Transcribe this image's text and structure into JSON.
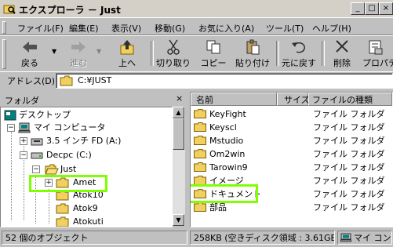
{
  "window": {
    "title": "エクスプローラ － Just",
    "min_glyph": "_",
    "max_glyph": "□",
    "close_glyph": "×"
  },
  "menu": [
    "ファイル(F)",
    "編集(E)",
    "表示(V)",
    "移動(G)",
    "お気に入り(A)",
    "ツール(T)",
    "ヘルプ(H)"
  ],
  "toolbar": {
    "back": "戻る",
    "forward": "進む",
    "up": "上へ",
    "cut": "切り取り",
    "copy": "コピー",
    "paste": "貼り付け",
    "undo": "元に戻す",
    "delete": "削除",
    "properties": "プロパティ"
  },
  "address": {
    "label": "アドレス(D)",
    "value": "C:¥JUST"
  },
  "tree": {
    "header": "フォルダ",
    "close_glyph": "×",
    "items": [
      {
        "label": "デスクトップ",
        "icon": "desktop-icon"
      },
      {
        "label": "マイ コンピュータ",
        "icon": "computer-icon",
        "expander": "−"
      },
      {
        "label": "3.5 インチ FD (A:)",
        "icon": "floppy-icon",
        "expander": "+"
      },
      {
        "label": "Decpc (C:)",
        "icon": "drive-icon",
        "expander": "−"
      },
      {
        "label": "Just",
        "icon": "folder-open-icon",
        "expander": "−"
      },
      {
        "label": "Amet",
        "icon": "folder-icon",
        "expander": "+"
      },
      {
        "label": "Atok10",
        "icon": "folder-icon"
      },
      {
        "label": "Atok9",
        "icon": "folder-icon"
      },
      {
        "label": "Atokuti",
        "icon": "folder-icon"
      }
    ]
  },
  "list": {
    "columns": [
      "名前",
      "サイズ",
      "ファイルの種類"
    ],
    "rows": [
      {
        "name": "KeyFight",
        "type": "ファイル フォルダ"
      },
      {
        "name": "Keyscl",
        "type": "ファイル フォルダ"
      },
      {
        "name": "Mstudio",
        "type": "ファイル フォルダ"
      },
      {
        "name": "Om2win",
        "type": "ファイル フォルダ"
      },
      {
        "name": "Tarowin9",
        "type": "ファイル フォルダ"
      },
      {
        "name": "イメージ",
        "type": "ファイル フォルダ"
      },
      {
        "name": "ドキュメント",
        "type": "ファイル フォルダ"
      },
      {
        "name": "部品",
        "type": "ファイル フォルダ"
      }
    ]
  },
  "status": {
    "count": "52 個のオブジェクト",
    "size": "258KB (空きディスク領域 : 3.61GB)",
    "location": "マイ コンピュータ"
  },
  "colors": {
    "highlight": "#7fff00",
    "folder": "#f0d060",
    "face": "#c0c0c0"
  }
}
